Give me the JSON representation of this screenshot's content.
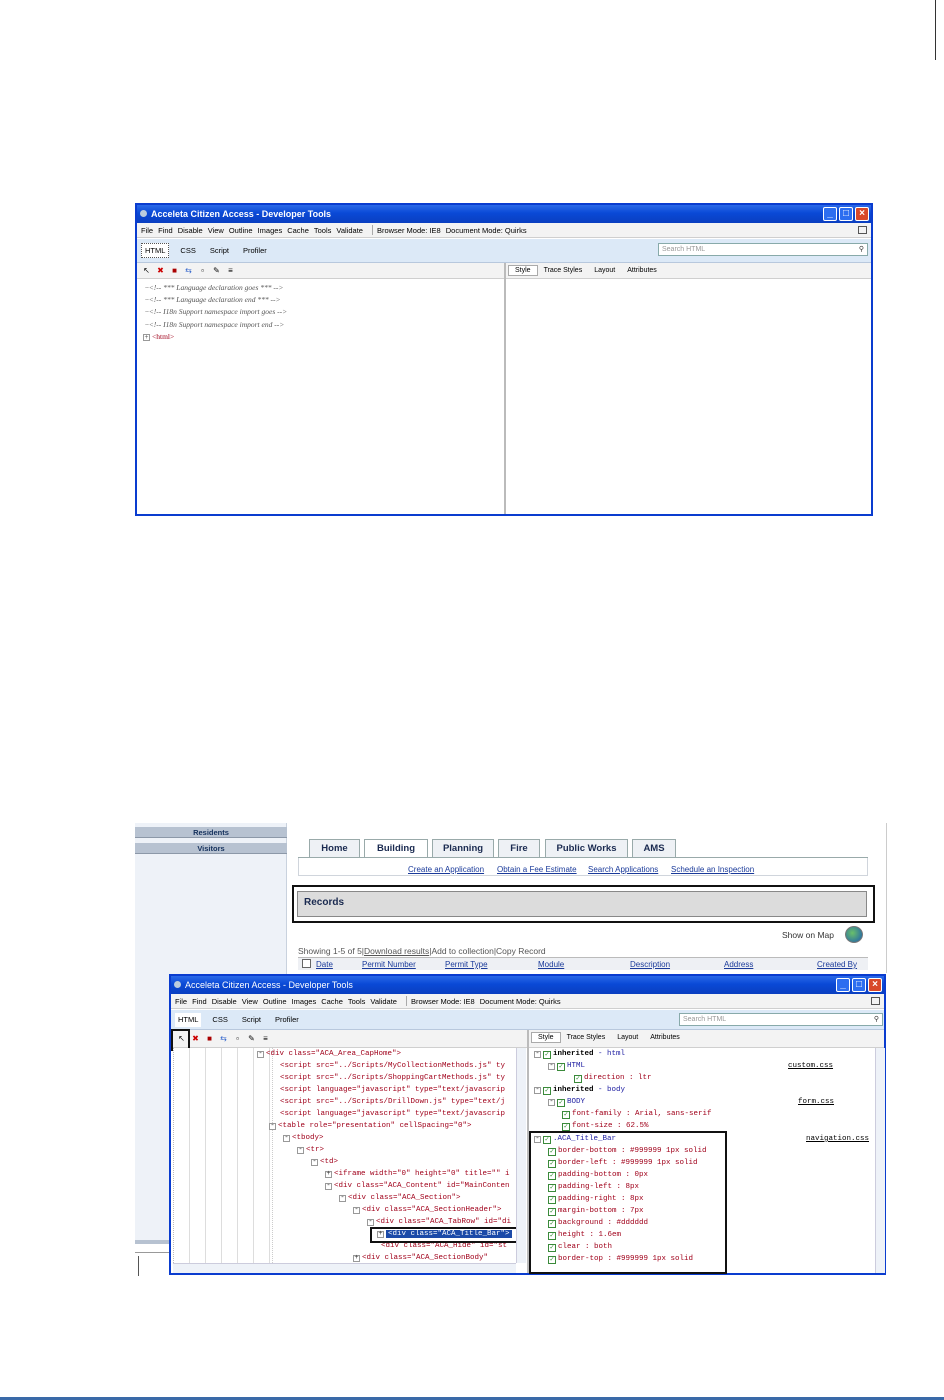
{
  "top_window": {
    "title": "Acceleta Citizen Access - Developer Tools",
    "menu": [
      "File",
      "Find",
      "Disable",
      "View",
      "Outline",
      "Images",
      "Cache",
      "Tools",
      "Validate"
    ],
    "browser_mode": "Browser Mode: IE8",
    "document_mode": "Document Mode: Quirks",
    "tabs": [
      "HTML",
      "CSS",
      "Script",
      "Profiler"
    ],
    "search_placeholder": "Search HTML",
    "right_tabs": [
      "Style",
      "Trace Styles",
      "Layout",
      "Attributes"
    ],
    "tree": [
      "<!-- *** Language declaration goes *** -->",
      "<!-- *** Language declaration end *** -->",
      "<!-- I18n Support namespace import goes -->",
      "<!-- I18n Support namespace import end -->",
      "<html>"
    ]
  },
  "page": {
    "sidebar": [
      "Residents",
      "Visitors"
    ],
    "nav_tabs": [
      "Home",
      "Building",
      "Planning",
      "Fire",
      "Public Works",
      "AMS"
    ],
    "links": [
      "Create an Application",
      "Obtain a Fee Estimate",
      "Search Applications",
      "Schedule an Inspection"
    ],
    "records_title": "Records",
    "show_on_map": "Show on Map",
    "showing": "Showing 1-5 of 5",
    "download": "Download results",
    "add_collection": "Add to collection",
    "copy_record": "Copy Record",
    "columns": [
      "Date",
      "Permit Number",
      "Permit Type",
      "Module",
      "Description",
      "Address",
      "Created By"
    ]
  },
  "bottom_window": {
    "title": "Acceleta Citizen Access - Developer Tools",
    "menu": [
      "File",
      "Find",
      "Disable",
      "View",
      "Outline",
      "Images",
      "Cache",
      "Tools",
      "Validate"
    ],
    "browser_mode": "Browser Mode: IE8",
    "document_mode": "Document Mode: Quirks",
    "tabs": [
      "HTML",
      "CSS",
      "Script",
      "Profiler"
    ],
    "search_placeholder": "Search HTML",
    "right_tabs": [
      "Style",
      "Trace Styles",
      "Layout",
      "Attributes"
    ],
    "tree": [
      "<div class=\"ACA_Area_CapHome\">",
      "<script src=\"../Scripts/MyCollectionMethods.js\" ty",
      "<script src=\"../Scripts/ShoppingCartMethods.js\" ty",
      "<script language=\"javascript\" type=\"text/javascrip",
      "<script src=\"../Scripts/DrillDown.js\" type=\"text/j",
      "<script language=\"javascript\" type=\"text/javascrip",
      "<table role=\"presentation\" cellSpacing=\"0\">",
      "<tbody>",
      "<tr>",
      "<td>",
      "<iframe width=\"0\" height=\"0\" title=\"\" i",
      "<div class=\"ACA_Content\" id=\"MainConten",
      "<div class=\"ACA_Section\">",
      "<div class=\"ACA_SectionHeader\">",
      "<div class=\"ACA_TabRow\" id=\"di",
      "<div class=\"ACA_Title_Bar\">",
      "<div class=\"ACA_Hide\" id=\"st",
      "<div class=\"ACA_SectionBody\""
    ],
    "styles": {
      "inherited_html": "inherited",
      "inherited_html_suffix": "- html",
      "html_selector": "HTML",
      "html_prop": "direction : ltr",
      "html_file": "custom.css",
      "inherited_body": "inherited",
      "inherited_body_suffix": "- body",
      "body_selector": "BODY",
      "body_props": [
        "font-family : Arial, sans-serif",
        "font-size : 62.5%"
      ],
      "body_file": "form.css",
      "title_selector": ".ACA_Title_Bar",
      "title_file": "navigation.css",
      "title_props": [
        "border-bottom : #999999 1px solid",
        "border-left : #999999 1px solid",
        "padding-bottom : 0px",
        "padding-left : 8px",
        "padding-right : 8px",
        "margin-bottom : 7px",
        "background : #dddddd",
        "height : 1.6em",
        "clear : both",
        "border-top : #999999 1px solid"
      ]
    }
  }
}
